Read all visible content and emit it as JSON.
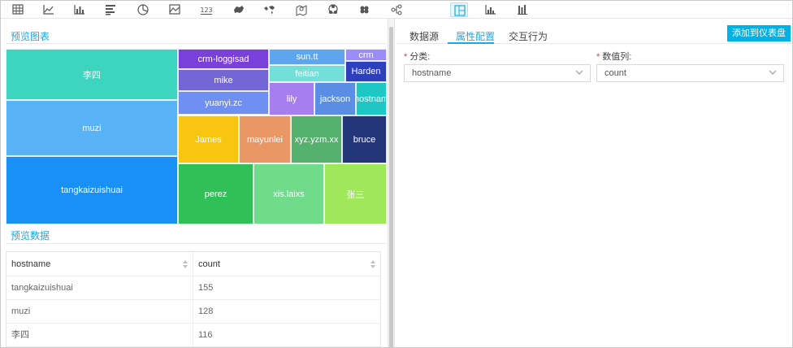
{
  "toolbar": {
    "icons": [
      "table-icon",
      "line-chart-icon",
      "bar-chart-icon",
      "horizontal-bar-icon",
      "pie-chart-icon",
      "area-chart-icon",
      "kpi-number-icon",
      "china-map-icon",
      "world-map-icon",
      "geo-pin-map-icon",
      "relation-graph-icon",
      "scatter-icon",
      "tree-icon",
      "treemap-icon",
      "histogram-icon",
      "stacked-bar-icon"
    ],
    "kpi_text": "123",
    "active": "treemap-icon"
  },
  "preview": {
    "chart_title": "预览图表",
    "data_title": "预览数据"
  },
  "chart_data": {
    "type": "treemap",
    "items": [
      {
        "name": "李四",
        "value": 116,
        "color": "#3dd5bf"
      },
      {
        "name": "muzi",
        "value": 128,
        "color": "#5ab2f6"
      },
      {
        "name": "tangkaizuishuai",
        "value": 155,
        "color": "#1890f5"
      },
      {
        "name": "crm-loggisad",
        "color": "#7b3fdc"
      },
      {
        "name": "mike",
        "color": "#7466d4"
      },
      {
        "name": "yuanyi.zc",
        "color": "#6f8ff2"
      },
      {
        "name": "sun.tt",
        "color": "#5ea5f0"
      },
      {
        "name": "crm",
        "color": "#9a8df5"
      },
      {
        "name": "feitian",
        "color": "#72dfd9"
      },
      {
        "name": "Harden",
        "color": "#2d3fbd"
      },
      {
        "name": "lily",
        "color": "#a77df2"
      },
      {
        "name": "jackson",
        "color": "#5a8ee4"
      },
      {
        "name": "hostnam",
        "color": "#1dc7c4"
      },
      {
        "name": "James",
        "color": "#f8c611"
      },
      {
        "name": "mayunlei",
        "color": "#ea9766"
      },
      {
        "name": "xyz.yzm.xx",
        "color": "#56b06e"
      },
      {
        "name": "bruce",
        "color": "#253579"
      },
      {
        "name": "perez",
        "color": "#2fc158"
      },
      {
        "name": "xis.laixs",
        "color": "#6fdb8b"
      },
      {
        "name": "张三",
        "color": "#9ee85a"
      }
    ]
  },
  "table": {
    "columns": [
      "hostname",
      "count"
    ],
    "rows": [
      [
        "tangkaizuishuai",
        "155"
      ],
      [
        "muzi",
        "128"
      ],
      [
        "李四",
        "116"
      ]
    ]
  },
  "config": {
    "tabs": [
      "数据源",
      "属性配置",
      "交互行为"
    ],
    "active_tab": "属性配置",
    "add_button": "添加到仪表盘",
    "category_label": "分类:",
    "category_value": "hostname",
    "value_label": "数值列:",
    "value_value": "count",
    "required_mark": "*",
    "accent": "#1fa7e0"
  }
}
